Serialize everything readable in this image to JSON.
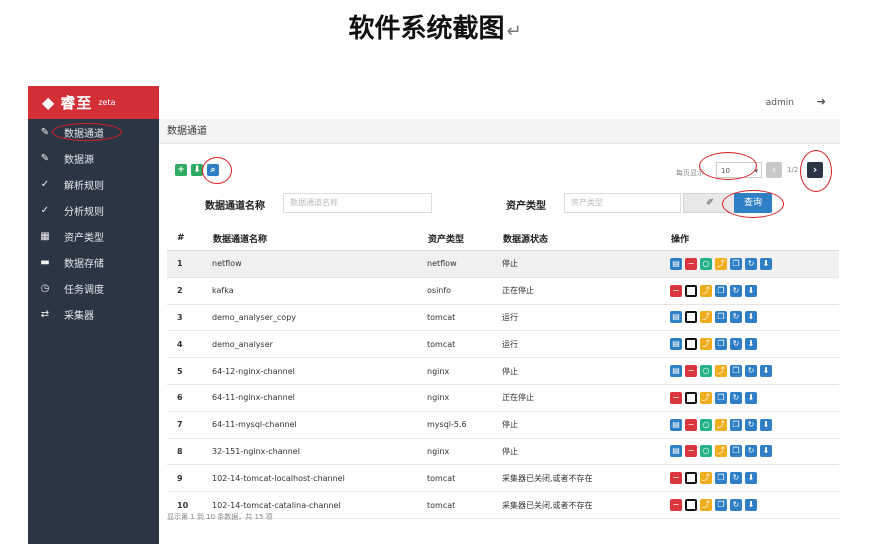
{
  "doc": {
    "title": "软件系统截图",
    "return_mark": "↵"
  },
  "brand": {
    "logo": "◆",
    "name": "睿至",
    "sub": "zeta"
  },
  "sidebar": {
    "items": [
      {
        "label": "数据通道",
        "icon": "✎"
      },
      {
        "label": "数据源",
        "icon": "✎"
      },
      {
        "label": "解析规则",
        "icon": "✓"
      },
      {
        "label": "分析规则",
        "icon": "✓"
      },
      {
        "label": "资产类型",
        "icon": "▦"
      },
      {
        "label": "数据存储",
        "icon": "▬"
      },
      {
        "label": "任务调度",
        "icon": "◷"
      },
      {
        "label": "采集器",
        "icon": "⇄"
      }
    ]
  },
  "topbar": {
    "user": "admin",
    "logout_icon": "➜"
  },
  "breadcrumb": "数据通道",
  "toolbar": {
    "add_icon": "+",
    "import_icon": "⬇",
    "search_icon": "⌕"
  },
  "pager": {
    "label": "每页显示",
    "page_size": "10",
    "info": "1/2",
    "prev": "‹",
    "next": "›"
  },
  "filters": {
    "name_label": "数据通道名称",
    "name_placeholder": "数据通道名称",
    "type_label": "资产类型",
    "type_placeholder": "资产类型",
    "clear_icon": "✐",
    "query_label": "查询"
  },
  "table": {
    "headers": [
      "#",
      "数据通道名称",
      "资产类型",
      "数据源状态",
      "操作"
    ],
    "rows": [
      {
        "n": "1",
        "name": "netflow",
        "type": "netflow",
        "state": "停止",
        "ops": [
          "doc",
          "minus",
          "gcircle",
          "ychart",
          "copy",
          "refresh",
          "down"
        ]
      },
      {
        "n": "2",
        "name": "kafka",
        "type": "osinfo",
        "state": "正在停止",
        "ops": [
          "minus",
          "sq",
          "ychart",
          "copy",
          "refresh",
          "down"
        ]
      },
      {
        "n": "3",
        "name": "demo_analyser_copy",
        "type": "tomcat",
        "state": "运行",
        "ops": [
          "bdoc",
          "sq",
          "ychart",
          "copy",
          "refresh",
          "down"
        ]
      },
      {
        "n": "4",
        "name": "demo_analyser",
        "type": "tomcat",
        "state": "运行",
        "ops": [
          "bdoc",
          "sq",
          "ychart",
          "copy",
          "refresh",
          "down"
        ]
      },
      {
        "n": "5",
        "name": "64-12-nginx-channel",
        "type": "nginx",
        "state": "停止",
        "ops": [
          "doc",
          "minus",
          "gcircle",
          "ychart",
          "copy",
          "refresh",
          "down"
        ]
      },
      {
        "n": "6",
        "name": "64-11-nginx-channel",
        "type": "nginx",
        "state": "正在停止",
        "ops": [
          "minus",
          "sq",
          "ychart",
          "copy",
          "refresh",
          "down"
        ]
      },
      {
        "n": "7",
        "name": "64-11-mysql-channel",
        "type": "mysql-5.6",
        "state": "停止",
        "ops": [
          "doc",
          "minus",
          "gcircle",
          "ychart",
          "copy",
          "refresh",
          "down"
        ]
      },
      {
        "n": "8",
        "name": "32-151-nginx-channel",
        "type": "nginx",
        "state": "停止",
        "ops": [
          "doc",
          "minus",
          "gcircle",
          "ychart",
          "copy",
          "refresh",
          "down"
        ]
      },
      {
        "n": "9",
        "name": "102-14-tomcat-localhost-channel",
        "type": "tomcat",
        "state": "采集器已关闭,或者不存在",
        "ops": [
          "minus",
          "sq",
          "ychart",
          "copy",
          "refresh",
          "down"
        ]
      },
      {
        "n": "10",
        "name": "102-14-tomcat-catalina-channel",
        "type": "tomcat",
        "state": "采集器已关闭,或者不存在",
        "ops": [
          "minus",
          "sq",
          "ychart",
          "copy",
          "refresh",
          "down"
        ]
      }
    ]
  },
  "op_glyphs": {
    "doc": "▤",
    "minus": "−",
    "gcircle": "○",
    "ychart": "⤴",
    "copy": "❐",
    "refresh": "↻",
    "down": "⬇",
    "sq": "",
    "bdoc": "▤"
  },
  "footer": "显示第 1 到 10 条数据，共 15 项",
  "colors": {
    "sidebar": "#2b3543",
    "brand": "#d32f36",
    "primary": "#2f7fc6",
    "annotation": "#d81f26"
  }
}
